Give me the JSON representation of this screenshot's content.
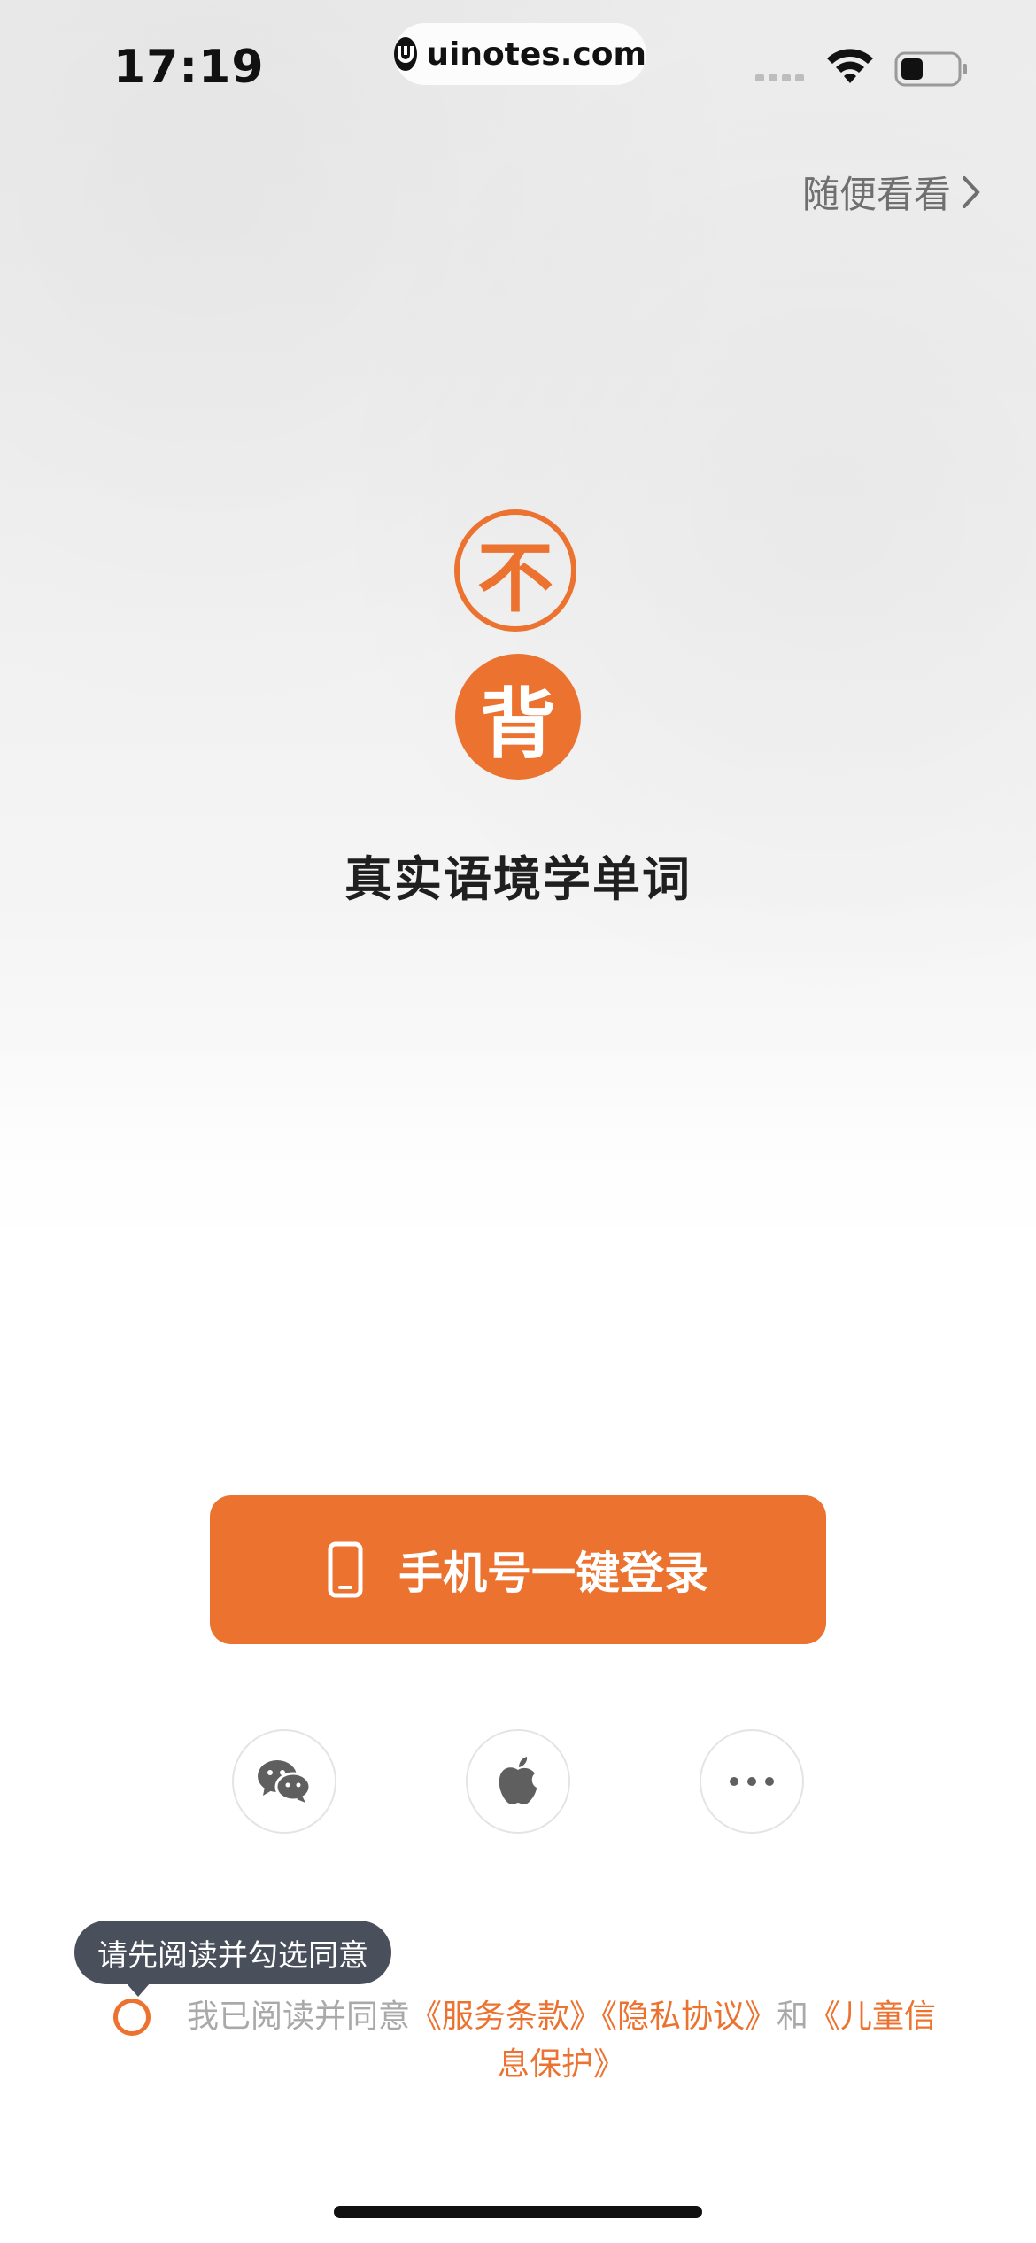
{
  "status_bar": {
    "time": "17:19",
    "url": "uinotes.com"
  },
  "header": {
    "browse_label": "随便看看"
  },
  "logo": {
    "top_char": "不",
    "bottom_char": "背"
  },
  "slogan": "真实语境学单词",
  "login": {
    "phone_login_label": "手机号一键登录"
  },
  "social_login": [
    {
      "name": "wechat",
      "icon": "wechat-icon"
    },
    {
      "name": "apple",
      "icon": "apple-icon"
    },
    {
      "name": "more",
      "icon": "more-icon"
    }
  ],
  "agreement": {
    "tooltip": "请先阅读并勾选同意",
    "prefix": "我已阅读并同意",
    "terms": "《服务条款》",
    "privacy": "《隐私协议》",
    "and": "和",
    "children": "《儿童信息保护》"
  },
  "colors": {
    "accent": "#ec7230",
    "tooltip_bg": "#4a4f5c"
  }
}
